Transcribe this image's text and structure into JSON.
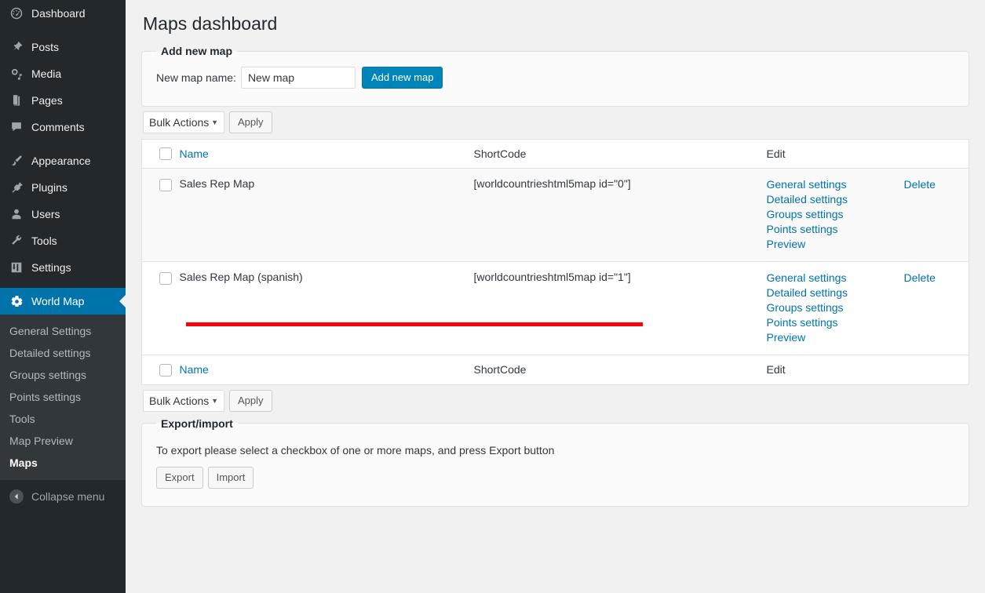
{
  "sidebar": {
    "items": [
      {
        "label": "Dashboard",
        "icon": "dashboard-icon",
        "name": "dashboard"
      },
      {
        "label": "Posts",
        "icon": "pin-icon",
        "name": "posts"
      },
      {
        "label": "Media",
        "icon": "media-icon",
        "name": "media"
      },
      {
        "label": "Pages",
        "icon": "pages-icon",
        "name": "pages"
      },
      {
        "label": "Comments",
        "icon": "comment-icon",
        "name": "comments"
      },
      {
        "label": "Appearance",
        "icon": "brush-icon",
        "name": "appearance"
      },
      {
        "label": "Plugins",
        "icon": "plug-icon",
        "name": "plugins"
      },
      {
        "label": "Users",
        "icon": "user-icon",
        "name": "users"
      },
      {
        "label": "Tools",
        "icon": "wrench-icon",
        "name": "tools"
      },
      {
        "label": "Settings",
        "icon": "sliders-icon",
        "name": "settings"
      }
    ],
    "active": {
      "label": "World Map",
      "icon": "gear-icon",
      "name": "world-map"
    },
    "submenu": [
      {
        "label": "General Settings",
        "current": false
      },
      {
        "label": "Detailed settings",
        "current": false
      },
      {
        "label": "Groups settings",
        "current": false
      },
      {
        "label": "Points settings",
        "current": false
      },
      {
        "label": "Tools",
        "current": false
      },
      {
        "label": "Map Preview",
        "current": false
      },
      {
        "label": "Maps",
        "current": true
      }
    ],
    "collapse_label": "Collapse menu",
    "collapse_icon": "chevron-left-icon"
  },
  "page": {
    "title": "Maps dashboard"
  },
  "add_new_map": {
    "legend": "Add new map",
    "field_label": "New map name:",
    "input_value": "New map",
    "input_placeholder": "New map",
    "button_label": "Add new map"
  },
  "tablenav_top": {
    "bulk_label": "Bulk Actions",
    "caret_icon": "chevron-down-icon",
    "apply_label": "Apply"
  },
  "tablenav_bottom": {
    "bulk_label": "Bulk Actions",
    "caret_icon": "chevron-down-icon",
    "apply_label": "Apply"
  },
  "table": {
    "columns": {
      "name": "Name",
      "shortcode": "ShortCode",
      "edit": "Edit"
    },
    "rows": [
      {
        "name": "Sales Rep Map",
        "shortcode": "[worldcountrieshtml5map id=\"0\"]",
        "edit_links": [
          "General settings",
          "Detailed settings",
          "Groups settings",
          "Points settings",
          "Preview"
        ],
        "delete_label": "Delete"
      },
      {
        "name": "Sales Rep Map (spanish)",
        "shortcode": "[worldcountrieshtml5map id=\"1\"]",
        "edit_links": [
          "General settings",
          "Detailed settings",
          "Groups settings",
          "Points settings",
          "Preview"
        ],
        "delete_label": "Delete"
      }
    ]
  },
  "export_import": {
    "legend": "Export/import",
    "note": "To export please select a checkbox of one or more maps, and press Export button",
    "export_label": "Export",
    "import_label": "Import"
  },
  "annotation": {
    "color": "#fb0007"
  }
}
